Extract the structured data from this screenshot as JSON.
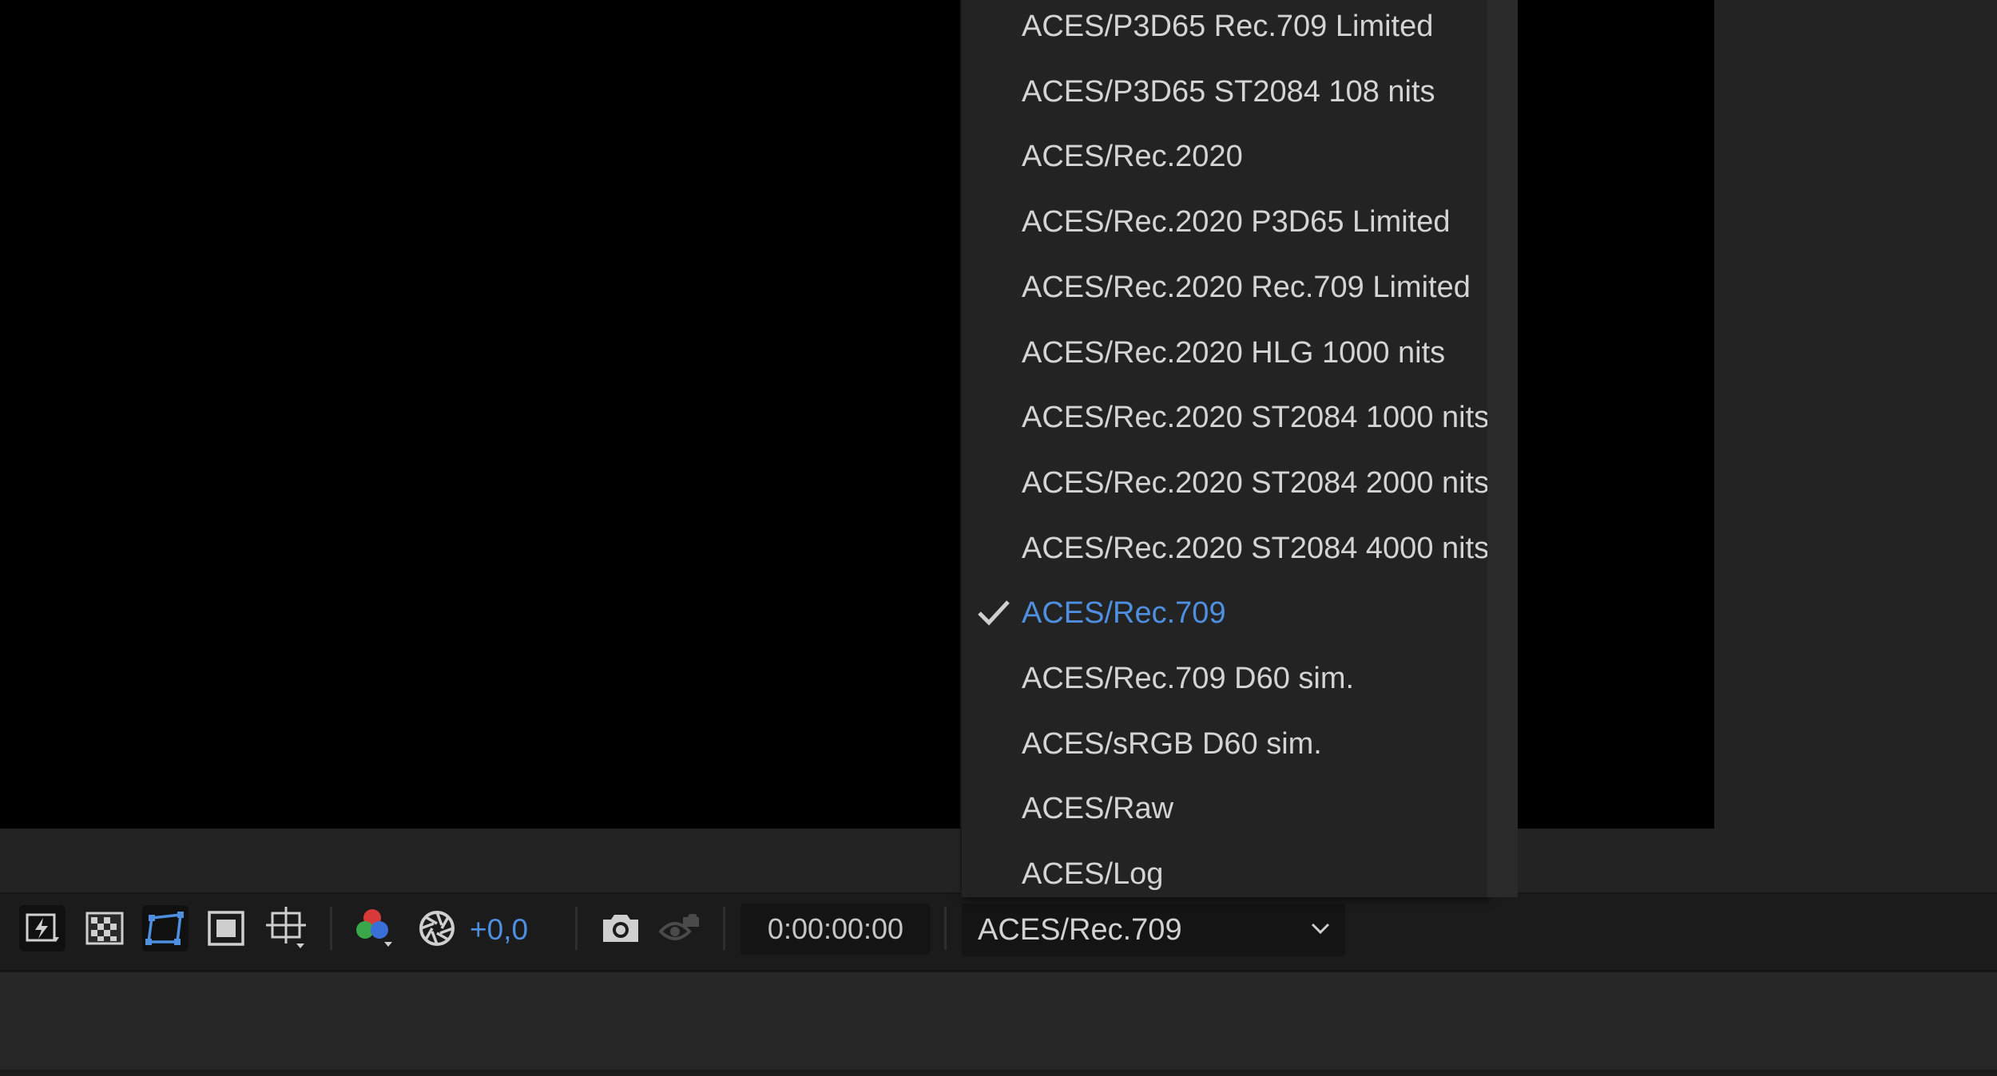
{
  "menu": {
    "items": [
      {
        "label": "ACES/P3D65 Rec.709 Limited",
        "selected": false
      },
      {
        "label": "ACES/P3D65 ST2084 108 nits",
        "selected": false
      },
      {
        "label": "ACES/Rec.2020",
        "selected": false
      },
      {
        "label": "ACES/Rec.2020 P3D65 Limited",
        "selected": false
      },
      {
        "label": "ACES/Rec.2020 Rec.709 Limited",
        "selected": false
      },
      {
        "label": "ACES/Rec.2020 HLG 1000 nits",
        "selected": false
      },
      {
        "label": "ACES/Rec.2020 ST2084 1000 nits",
        "selected": false
      },
      {
        "label": "ACES/Rec.2020 ST2084 2000 nits",
        "selected": false
      },
      {
        "label": "ACES/Rec.2020 ST2084 4000 nits",
        "selected": false
      },
      {
        "label": "ACES/Rec.709",
        "selected": true
      },
      {
        "label": "ACES/Rec.709 D60 sim.",
        "selected": false
      },
      {
        "label": "ACES/sRGB D60 sim.",
        "selected": false
      },
      {
        "label": "ACES/Raw",
        "selected": false
      },
      {
        "label": "ACES/Log",
        "selected": false
      }
    ]
  },
  "toolbar": {
    "icons": [
      "fast-previews-icon",
      "transparency-grid-icon",
      "mask-path-visibility-icon",
      "region-of-interest-icon",
      "toggle-guides-icon",
      "rgb-channels-icon",
      "reset-exposure-icon",
      "take-snapshot-icon",
      "show-snapshot-icon"
    ],
    "exposure_value": "+0,0",
    "timecode": "0:00:00:00",
    "view_dropdown_value": "ACES/Rec.709"
  },
  "colors": {
    "accent": "#4e8fe0",
    "background": "#232323",
    "viewer": "#000000",
    "text": "#d4d4d4"
  }
}
